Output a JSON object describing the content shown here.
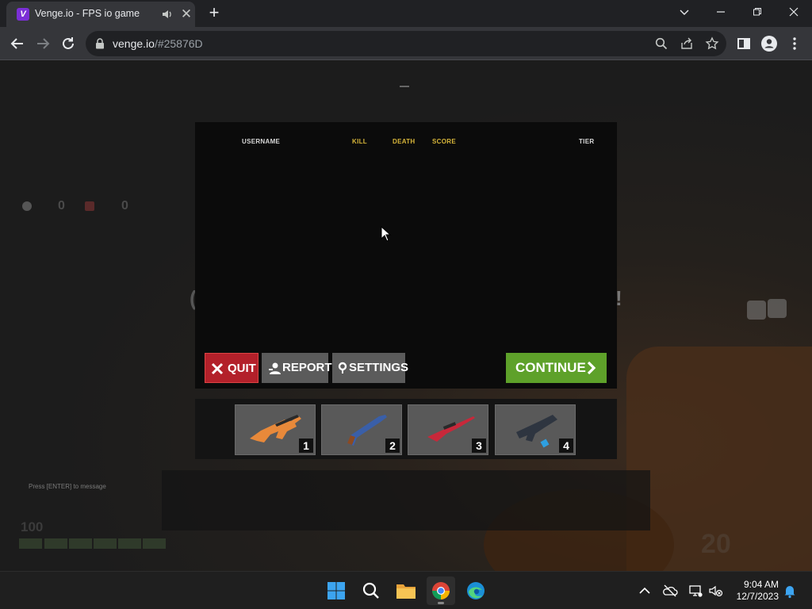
{
  "browser": {
    "tab_title": "Venge.io - FPS io game",
    "favicon_letter": "V",
    "url_host": "venge.io",
    "url_path": "/#25876D"
  },
  "game": {
    "scoreboard": {
      "columns": {
        "username": "USERNAME",
        "kill": "KILL",
        "death": "DEATH",
        "score": "SCORE",
        "tier": "TIER"
      }
    },
    "buttons": {
      "quit": "QUIT",
      "report": "REPORT",
      "settings": "SETTINGS",
      "continue": "CONTINUE"
    },
    "weapons": [
      {
        "slot": "1",
        "color": "#e8893a"
      },
      {
        "slot": "2",
        "color": "#3a5fa8"
      },
      {
        "slot": "3",
        "color": "#c8283a"
      },
      {
        "slot": "4",
        "color": "#2e6fa0"
      }
    ],
    "hud": {
      "team_score_left": "0",
      "team_score_right": "0",
      "health": "100",
      "ammo": "20",
      "chat_hint": "Press [ENTER] to message"
    }
  },
  "taskbar": {
    "time": "9:04 AM",
    "date": "12/7/2023"
  },
  "colors": {
    "continue_green": "#5ea12a",
    "quit_red": "#b3202a",
    "header_gold": "#d8b63a"
  }
}
